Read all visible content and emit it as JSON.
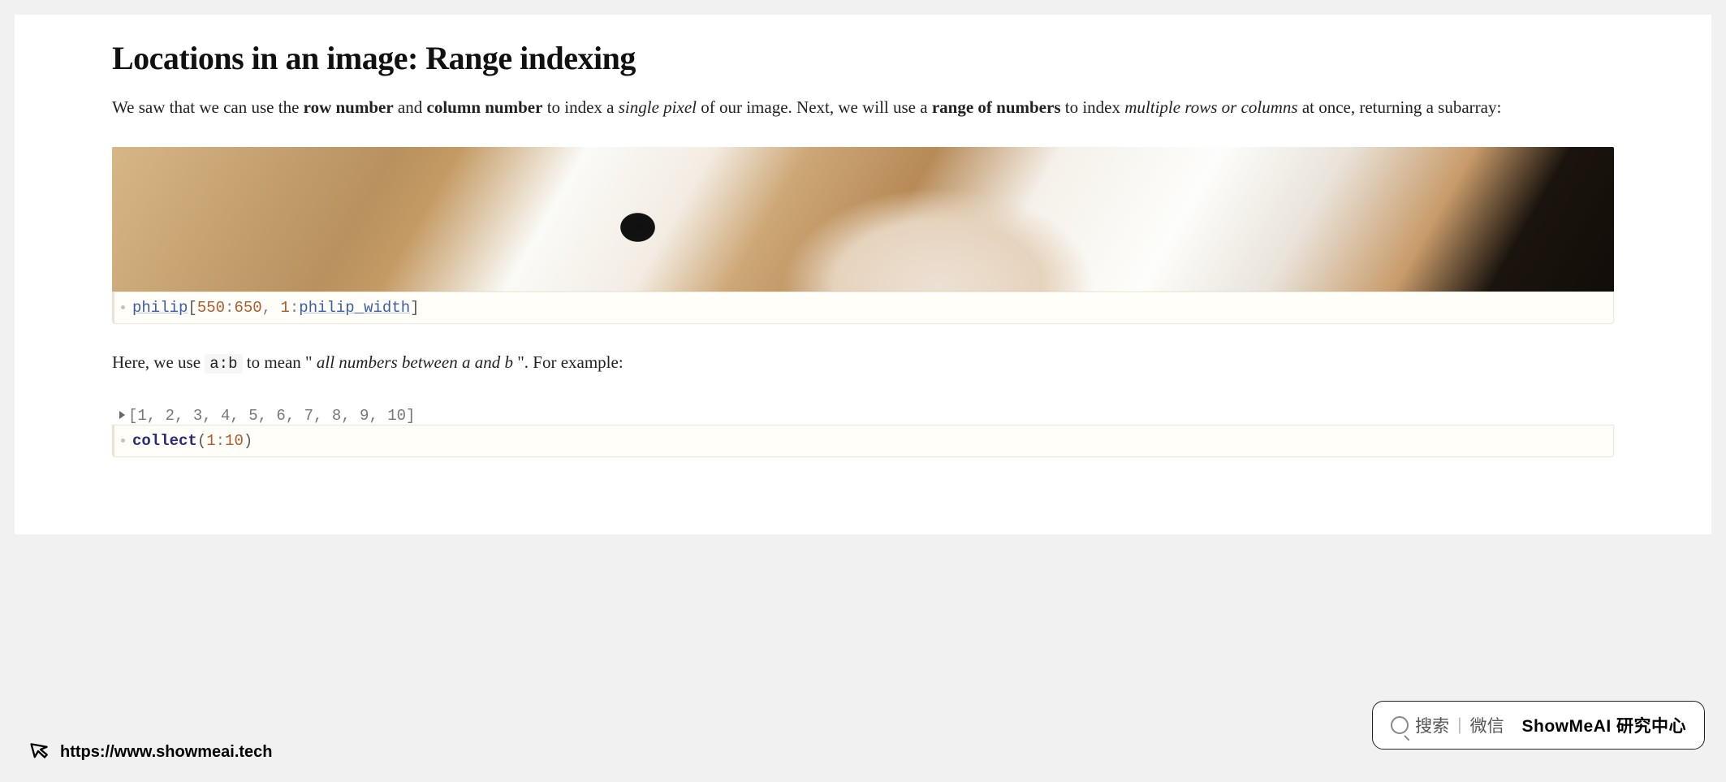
{
  "title": "Locations in an image: Range indexing",
  "para1": {
    "t1": "We saw that we can use the ",
    "b1": "row number",
    "t2": " and ",
    "b2": "column number",
    "t3": " to index a ",
    "i1": "single pixel",
    "t4": " of our image. Next, we will use a ",
    "b3": "range of numbers",
    "t5": " to index ",
    "i2": "multiple rows or columns",
    "t6": " at once, returning a subarray:"
  },
  "cell1": {
    "var1": "philip",
    "brk_open": "[",
    "n1": "550",
    "colon1": ":",
    "n2": "650",
    "comma": ", ",
    "n3": "1",
    "colon2": ":",
    "var2": "philip_width",
    "brk_close": "]"
  },
  "para2": {
    "t1": "Here, we use ",
    "code1": "a:b",
    "t2": " to mean \"",
    "i1": "all numbers between  a  and  b",
    "t3": " \". For example:"
  },
  "output2": "[1, 2, 3, 4, 5, 6, 7, 8, 9, 10]",
  "cell2": {
    "fun": "collect",
    "paren_open": "(",
    "n1": "1",
    "colon": ":",
    "n2": "10",
    "paren_close": ")"
  },
  "footer_url": "https://www.showmeai.tech",
  "search": {
    "label_search": "搜索",
    "label_wechat": "微信",
    "brand": "ShowMeAI 研究中心"
  }
}
